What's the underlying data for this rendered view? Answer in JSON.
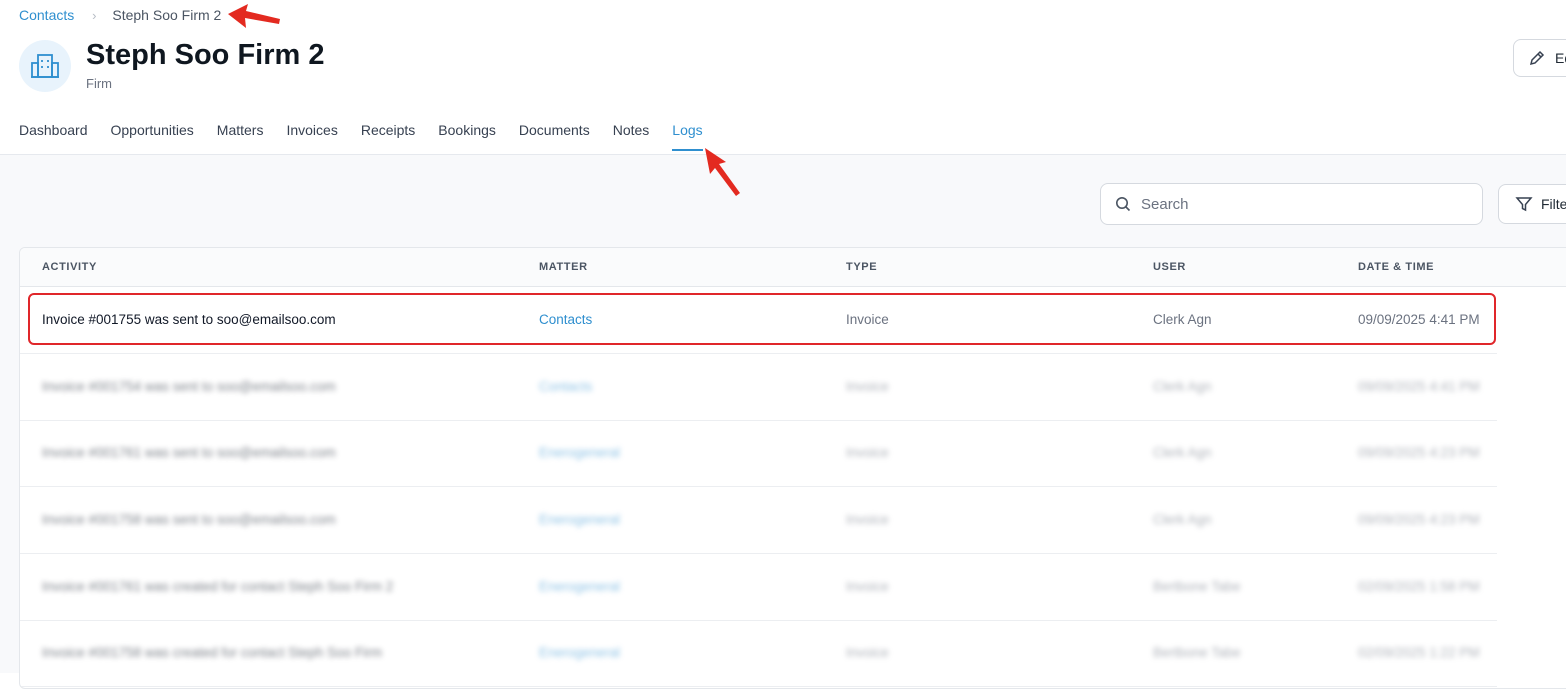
{
  "breadcrumb": {
    "parent": "Contacts",
    "current": "Steph Soo Firm 2"
  },
  "header": {
    "title": "Steph Soo Firm 2",
    "subtitle": "Firm",
    "edit_label": "Ed"
  },
  "tabs": [
    "Dashboard",
    "Opportunities",
    "Matters",
    "Invoices",
    "Receipts",
    "Bookings",
    "Documents",
    "Notes",
    "Logs"
  ],
  "active_tab": "Logs",
  "search": {
    "placeholder": "Search"
  },
  "filter": {
    "label": "Filte"
  },
  "table": {
    "headers": {
      "activity": "ACTIVITY",
      "matter": "MATTER",
      "type": "TYPE",
      "user": "USER",
      "datetime": "DATE & TIME"
    },
    "rows": [
      {
        "activity": "Invoice #001755 was sent to soo@emailsoo.com",
        "matter": "Contacts",
        "type": "Invoice",
        "user": "Clerk Agn",
        "datetime": "09/09/2025 4:41 PM"
      },
      {
        "activity": "Invoice #001754 was sent to soo@emailsoo.com",
        "matter": "Contacts",
        "type": "Invoice",
        "user": "Clerk Agn",
        "datetime": "09/09/2025 4:41 PM"
      },
      {
        "activity": "Invoice #001761 was sent to soo@emailsoo.com",
        "matter": "Enerogeneral",
        "type": "Invoice",
        "user": "Clerk Agn",
        "datetime": "09/09/2025 4:23 PM"
      },
      {
        "activity": "Invoice #001758 was sent to soo@emailsoo.com",
        "matter": "Enerogeneral",
        "type": "Invoice",
        "user": "Clerk Agn",
        "datetime": "09/09/2025 4:23 PM"
      },
      {
        "activity": "Invoice #001761 was created for contact Steph Soo Firm 2",
        "matter": "Enerogeneral",
        "type": "Invoice",
        "user": "Bertbone Tabe",
        "datetime": "02/09/2025 1:58 PM"
      },
      {
        "activity": "Invoice #001758 was created for contact Steph Soo Firm",
        "matter": "Enerogeneral",
        "type": "Invoice",
        "user": "Bertbone Tabe",
        "datetime": "02/09/2025 1:22 PM"
      }
    ]
  },
  "colors": {
    "accent": "#2f8fcf",
    "annotation": "#e0262a"
  }
}
